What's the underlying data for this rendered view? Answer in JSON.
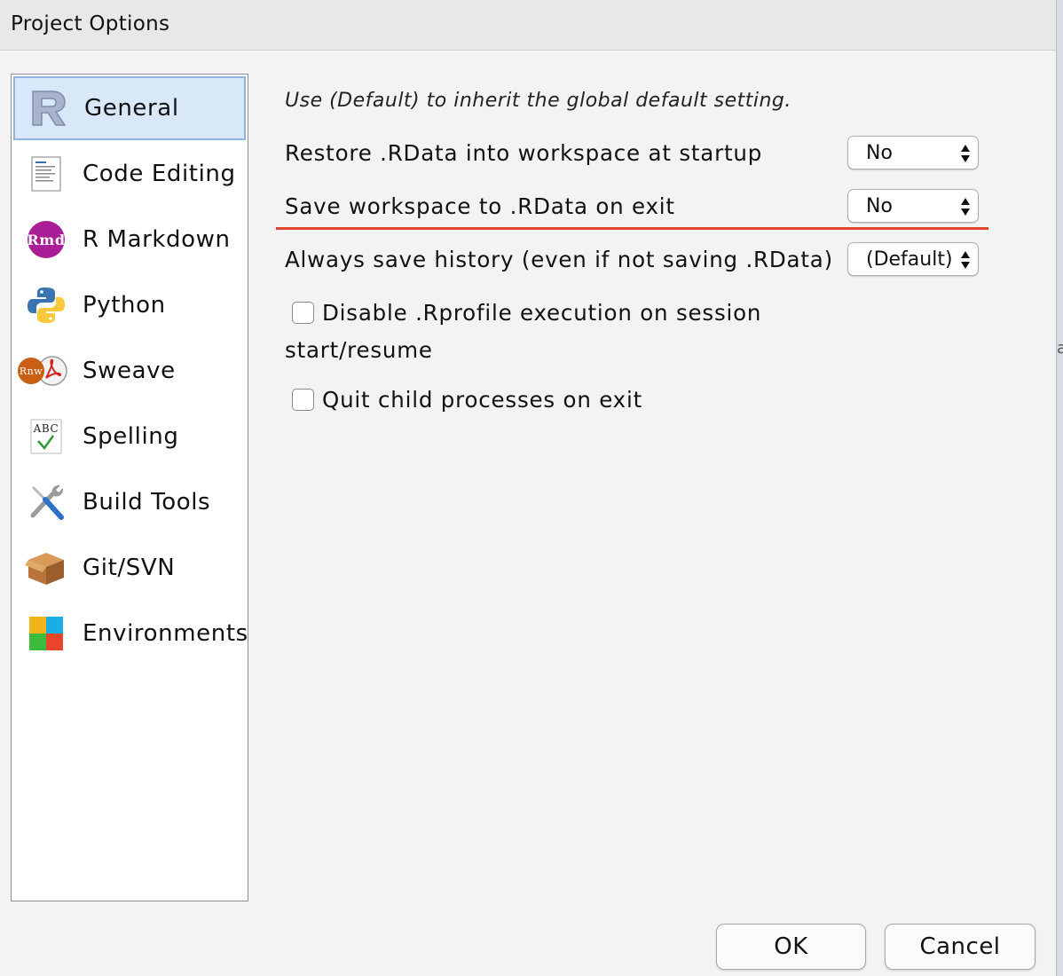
{
  "window": {
    "title": "Project Options"
  },
  "sidebar": {
    "items": [
      {
        "label": "General",
        "icon": "r-logo-icon",
        "selected": true
      },
      {
        "label": "Code Editing",
        "icon": "code-document-icon"
      },
      {
        "label": "R Markdown",
        "icon": "rmd-badge-icon"
      },
      {
        "label": "Python",
        "icon": "python-logo-icon"
      },
      {
        "label": "Sweave",
        "icon": "rnw-pdf-icon"
      },
      {
        "label": "Spelling",
        "icon": "abc-check-icon"
      },
      {
        "label": "Build Tools",
        "icon": "wrench-screwdriver-icon"
      },
      {
        "label": "Git/SVN",
        "icon": "package-box-icon"
      },
      {
        "label": "Environments",
        "icon": "colored-blocks-icon"
      }
    ]
  },
  "general": {
    "hint": "Use (Default) to inherit the global default setting.",
    "restore_label": "Restore .RData into workspace at startup",
    "restore_value": "No",
    "save_label": "Save workspace to .RData on exit",
    "save_value": "No",
    "history_label": "Always save history (even if not saving .RData)",
    "history_value": "(Default)",
    "disable_rprofile_label_line1": "Disable .Rprofile execution on session",
    "disable_rprofile_label_line2": "start/resume",
    "disable_rprofile_checked": false,
    "quit_child_label": "Quit child processes on exit",
    "quit_child_checked": false,
    "highlight_color": "#e0462c"
  },
  "buttons": {
    "ok": "OK",
    "cancel": "Cancel"
  },
  "colors": {
    "selection_bg": "#d8e8f8",
    "selection_border": "#8fb3d9"
  }
}
